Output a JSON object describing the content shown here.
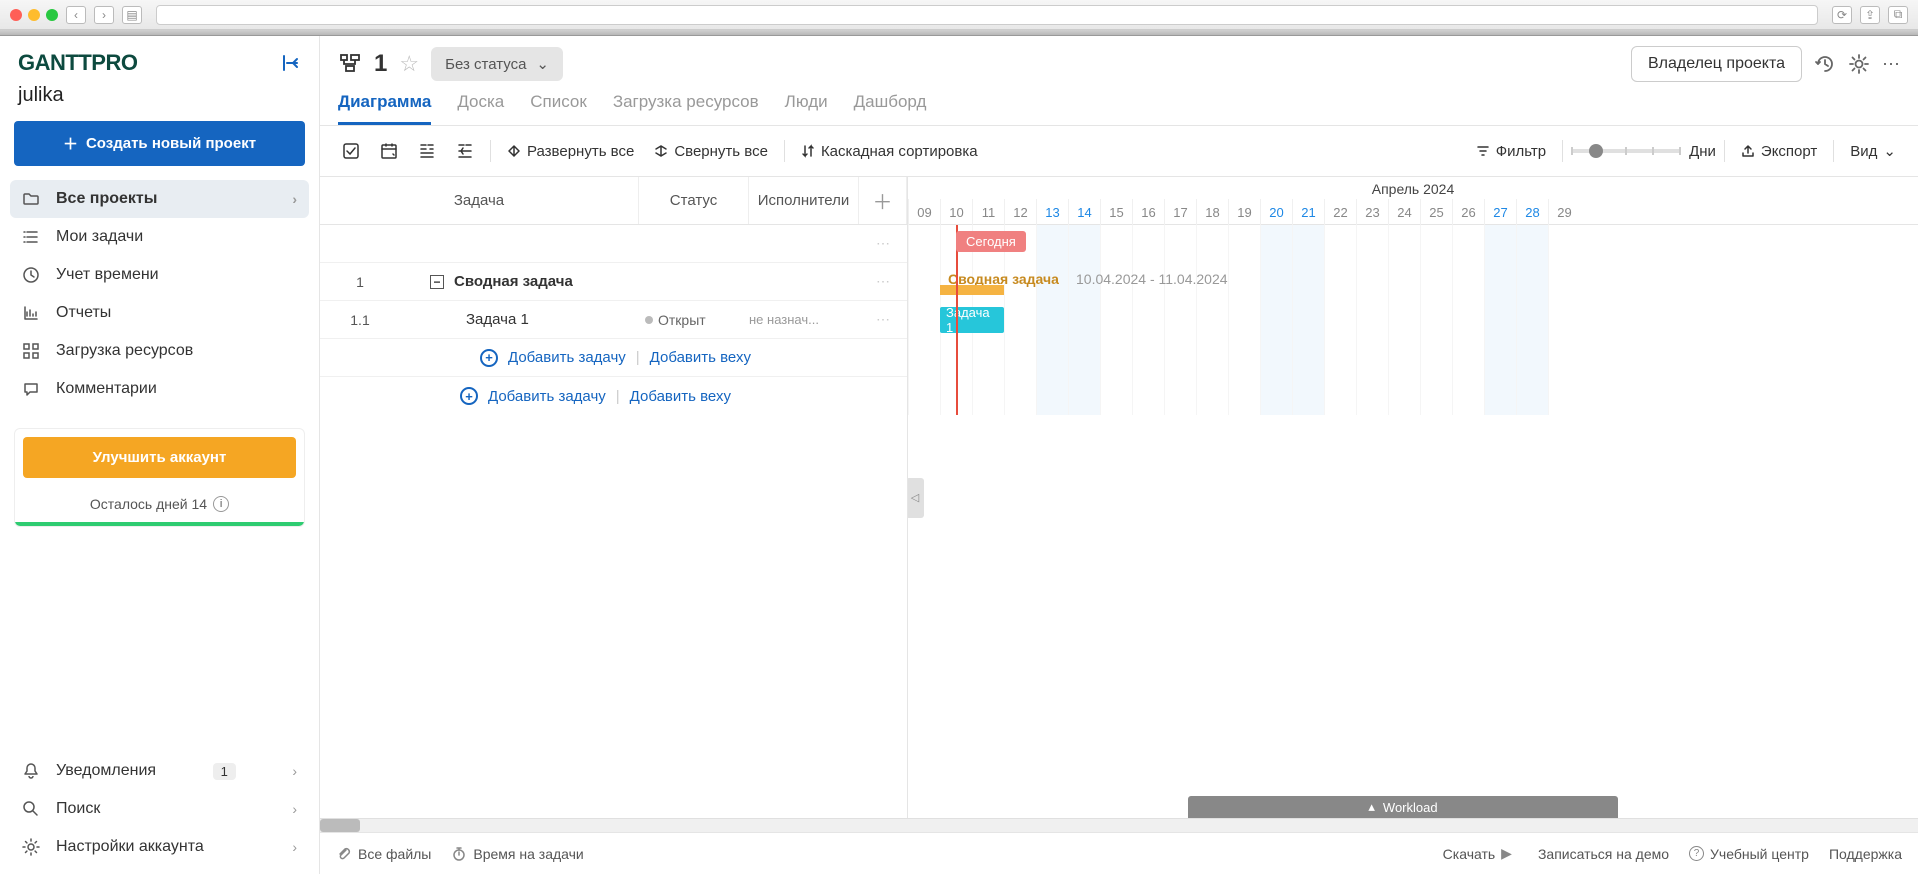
{
  "sidebar": {
    "logo": "GANTTPRO",
    "username": "julika",
    "create_project": "Создать новый проект",
    "nav": {
      "all_projects": "Все проекты",
      "my_tasks": "Мои задачи",
      "time_tracking": "Учет времени",
      "reports": "Отчеты",
      "workload": "Загрузка ресурсов",
      "comments": "Комментарии",
      "notifications": "Уведомления",
      "notifications_count": "1",
      "search": "Поиск",
      "account_settings": "Настройки аккаунта"
    },
    "upgrade": {
      "button": "Улучшить аккаунт",
      "trial": "Осталось дней 14"
    }
  },
  "header": {
    "project_name": "1",
    "status": "Без статуса",
    "owner": "Владелец проекта"
  },
  "tabs": {
    "diagram": "Диаграмма",
    "board": "Доска",
    "list": "Список",
    "workload": "Загрузка ресурсов",
    "people": "Люди",
    "dashboard": "Дашборд"
  },
  "toolbar": {
    "expand_all": "Развернуть все",
    "collapse_all": "Свернуть все",
    "cascade_sort": "Каскадная сортировка",
    "filter": "Фильтр",
    "zoom_unit": "Дни",
    "export": "Экспорт",
    "view": "Вид"
  },
  "grid": {
    "headers": {
      "task": "Задача",
      "status": "Статус",
      "assignee": "Исполнители"
    },
    "rows": [
      {
        "num": "1",
        "name": "Сводная задача",
        "summary": true
      },
      {
        "num": "1.1",
        "name": "Задача 1",
        "status": "Открыт",
        "assignee": "не назнач..."
      }
    ],
    "add_task": "Добавить задачу",
    "add_milestone": "Добавить веху"
  },
  "gantt": {
    "month": "Апрель 2024",
    "days": [
      "09",
      "10",
      "11",
      "12",
      "13",
      "14",
      "15",
      "16",
      "17",
      "18",
      "19",
      "20",
      "21",
      "22",
      "23",
      "24",
      "25",
      "26",
      "27",
      "28",
      "29"
    ],
    "weekend_idx": [
      4,
      5,
      11,
      12,
      18,
      19
    ],
    "today": "Сегодня",
    "summary_name": "Сводная задача",
    "summary_dates": "10.04.2024 - 11.04.2024",
    "task_name": "Задача 1",
    "workload": "Workload"
  },
  "footer": {
    "all_files": "Все файлы",
    "time_on_tasks": "Время на задачи",
    "download": "Скачать",
    "book_demo": "Записаться на демо",
    "learning_center": "Учебный центр",
    "support": "Поддержка"
  }
}
